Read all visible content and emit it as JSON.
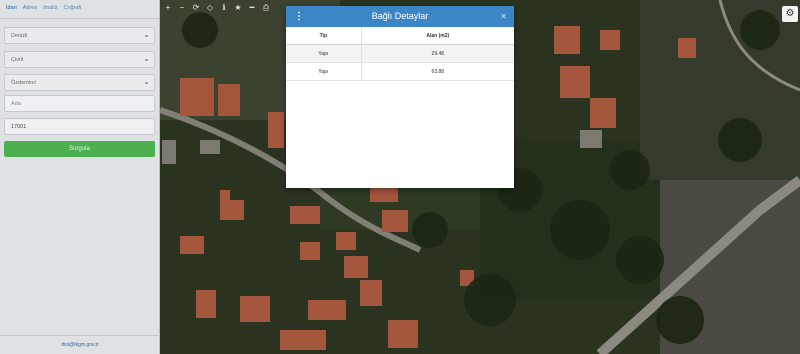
{
  "sidebar": {
    "tabs": [
      "İdari",
      "Adres",
      "Imaliz",
      "Coğrafi"
    ],
    "province": "Denizli",
    "district": "Çivril",
    "neighborhood": "Özdemirci",
    "block_placeholder": "Ada",
    "parcel_value": "17001",
    "query_button": "Sorgula",
    "footer_email": "dist@tkgm.gov.tr"
  },
  "toolbar": {
    "icons": [
      "move-icon",
      "zoom-out-icon",
      "refresh-icon",
      "locate-icon",
      "info-icon",
      "star-icon",
      "measure-icon",
      "print-icon"
    ],
    "glyphs": [
      "+",
      "−",
      "⟳",
      "◇",
      "ℹ",
      "★",
      "━",
      "⎙"
    ]
  },
  "modal": {
    "title": "Bağlı Detaylar",
    "columns": [
      "Tip",
      "Alan (m2)"
    ],
    "rows": [
      [
        "Yapı",
        "29.48"
      ],
      [
        "Yapı",
        "63.88"
      ]
    ]
  },
  "colors": {
    "header_blue": "#3d86c6",
    "button_green": "#4caf50"
  }
}
